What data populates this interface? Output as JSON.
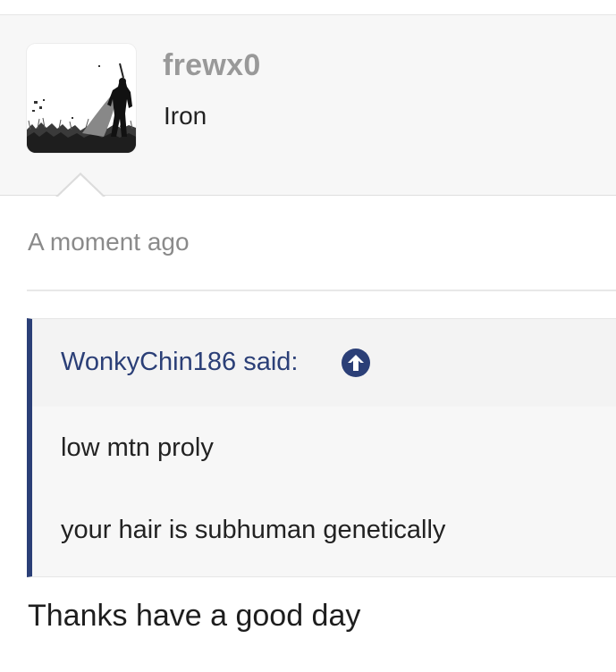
{
  "post": {
    "author": {
      "username": "frewx0",
      "user_title": "Iron",
      "avatar_icon": "avatar-image"
    },
    "timestamp": "A moment ago",
    "quote": {
      "attribution": "WonkyChin186 said:",
      "jump_icon": "arrow-up-circle-icon",
      "lines": [
        "low mtn proly",
        "your hair is subhuman genetically"
      ]
    },
    "body": "Thanks have a good day"
  },
  "colors": {
    "quote_accent": "#2b3f77",
    "username": "#999999",
    "timestamp": "#8a8a8a"
  }
}
